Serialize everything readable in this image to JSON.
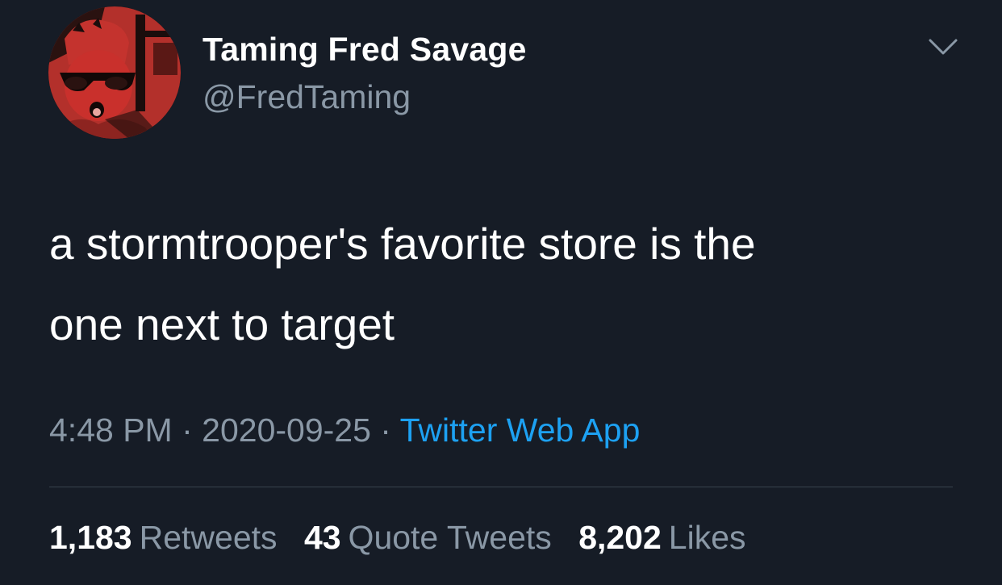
{
  "author": {
    "display_name": "Taming Fred Savage",
    "handle": "@FredTaming"
  },
  "tweet": {
    "text_lines": [
      "a stormtrooper's favorite store is the",
      "one next to target"
    ],
    "time": "4:48 PM",
    "date": "2020-09-25",
    "separator": "·",
    "source": "Twitter Web App"
  },
  "stats": {
    "retweets": {
      "count": "1,183",
      "label": "Retweets"
    },
    "quote_tweets": {
      "count": "43",
      "label": "Quote Tweets"
    },
    "likes": {
      "count": "8,202",
      "label": "Likes"
    }
  },
  "icons": {
    "menu": "chevron-down-icon"
  },
  "colors": {
    "background": "#161c26",
    "primary_text": "#ffffff",
    "secondary_text": "#8a98a6",
    "link": "#1da1f2",
    "divider": "#38444d",
    "avatar_red": "#c9302c"
  }
}
